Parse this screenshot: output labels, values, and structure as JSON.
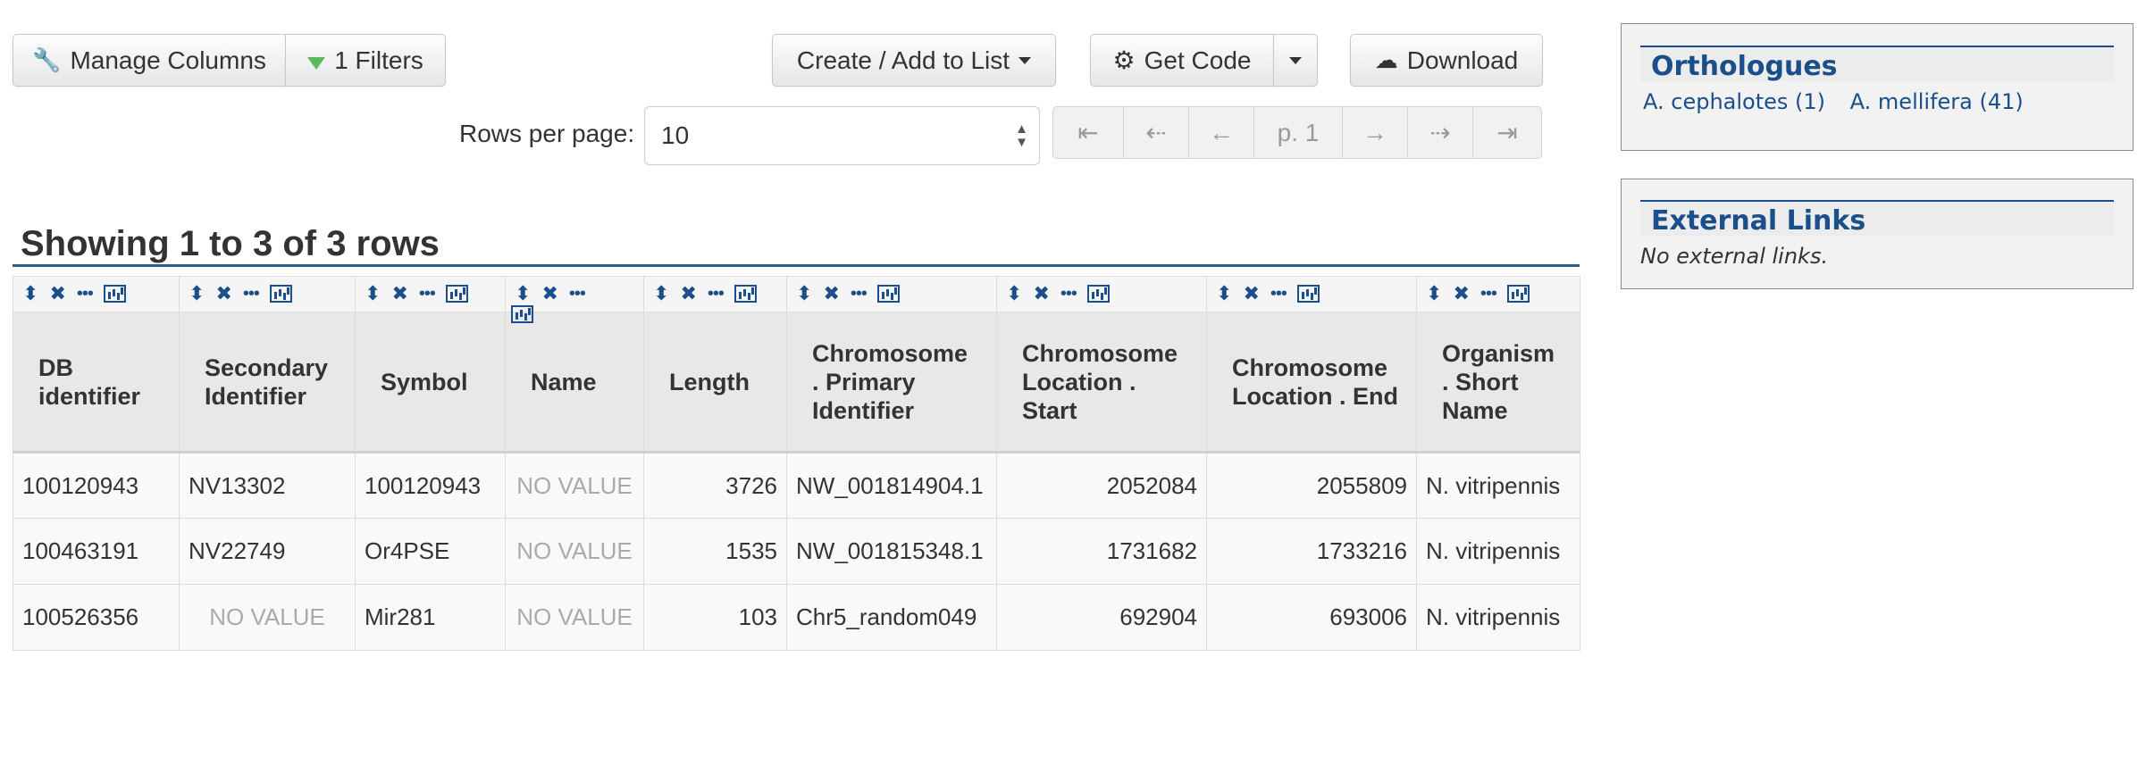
{
  "toolbar": {
    "manage_columns": "Manage Columns",
    "filters": "1 Filters",
    "create_add_to_list": "Create / Add to List",
    "get_code": "Get Code",
    "download": "Download",
    "icons": {
      "manage_columns": "wrench-icon",
      "filters": "filter-icon",
      "get_code": "gear-icon",
      "download": "cloud-download-icon"
    },
    "filter_icon_color": "#5cb85c"
  },
  "pagination": {
    "rows_per_page_label": "Rows per page:",
    "rows_per_page_value": "10",
    "first": "⇤",
    "prev_group": "⇠",
    "prev": "←",
    "page": "p. 1",
    "next": "→",
    "next_group": "⇢",
    "last": "⇥"
  },
  "results": {
    "summary": "Showing 1 to 3 of 3 rows",
    "columns": [
      "DB identifier",
      "Secondary Identifier",
      "Symbol",
      "Name",
      "Length",
      "Chromosome . Primary Identifier",
      "Chromosome Location . Start",
      "Chromosome Location . End",
      "Organism . Short Name"
    ],
    "rows": [
      [
        "100120943",
        "NV13302",
        "100120943",
        "NO VALUE",
        "3726",
        "NW_001814904.1",
        "2052084",
        "2055809",
        "N. vitripennis"
      ],
      [
        "100463191",
        "NV22749",
        "Or4PSE",
        "NO VALUE",
        "1535",
        "NW_001815348.1",
        "1731682",
        "1733216",
        "N. vitripennis"
      ],
      [
        "100526356",
        "NO VALUE",
        "Mir281",
        "NO VALUE",
        "103",
        "Chr5_random049",
        "692904",
        "693006",
        "N. vitripennis"
      ]
    ],
    "column_control_icons": [
      "sort-icon",
      "remove-column-icon",
      "more-options-icon",
      "column-summary-icon"
    ]
  },
  "orthologues": {
    "title": "Orthologues",
    "links": [
      "A. cephalotes (1)",
      "A. mellifera (41)"
    ]
  },
  "external_links": {
    "title": "External Links",
    "empty_text": "No external links."
  },
  "colors": {
    "accent": "#1a4f8b",
    "no_value": "#aaaaaa",
    "header_bg": "#e8e8e8"
  }
}
